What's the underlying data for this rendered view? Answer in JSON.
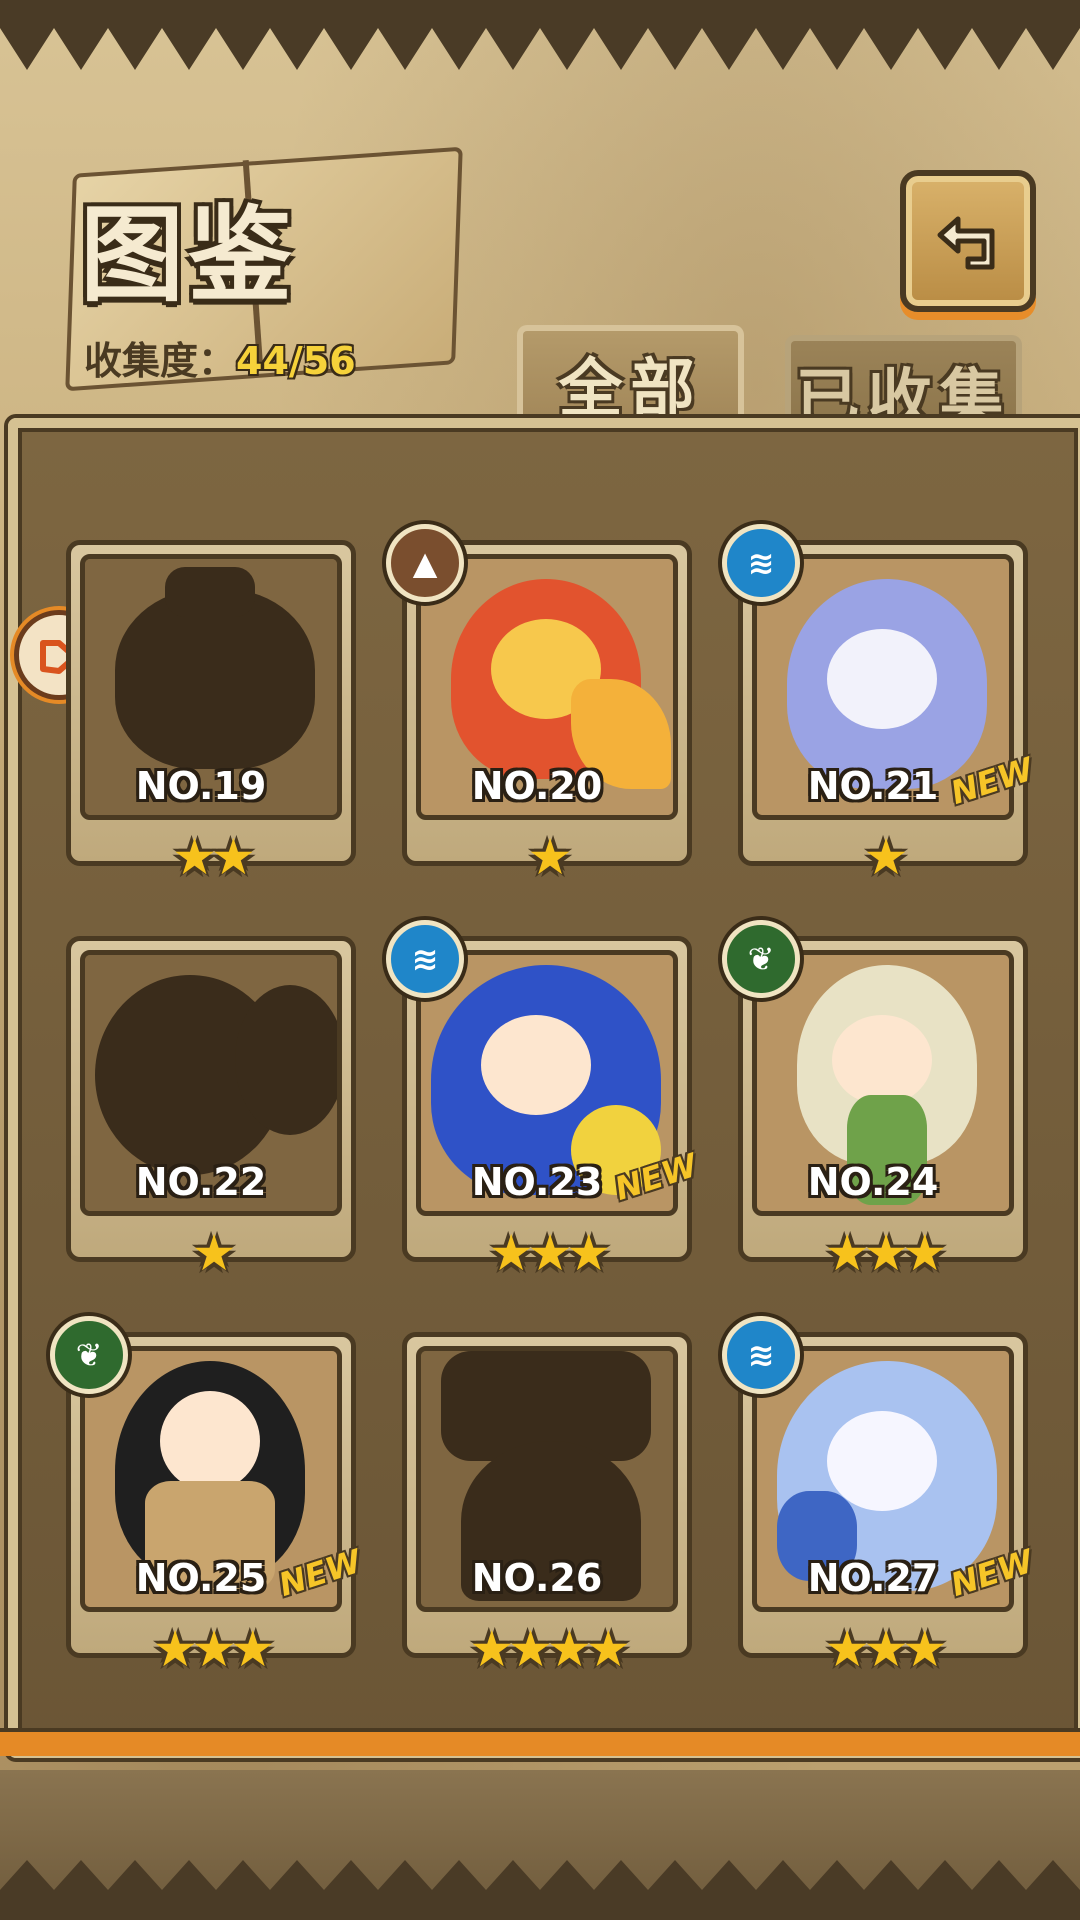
{
  "header": {
    "title": "图鉴",
    "collection_label": "收集度：",
    "collection_value": "44/56"
  },
  "tabs": [
    {
      "label": "全部",
      "active": true
    },
    {
      "label": "已收集",
      "active": false
    }
  ],
  "icons": {
    "back": "back-arrow-icon",
    "scroll": "arrow-marker-icon"
  },
  "cards": [
    {
      "no": "NO.19",
      "stars": "★★",
      "element": "",
      "known": false,
      "new": ""
    },
    {
      "no": "NO.20",
      "stars": "★",
      "element": "earth",
      "known": true,
      "new": ""
    },
    {
      "no": "NO.21",
      "stars": "★",
      "element": "water",
      "known": true,
      "new": "NEW"
    },
    {
      "no": "NO.22",
      "stars": "★",
      "element": "",
      "known": false,
      "new": ""
    },
    {
      "no": "NO.23",
      "stars": "★★★",
      "element": "water",
      "known": true,
      "new": "NEW"
    },
    {
      "no": "NO.24",
      "stars": "★★★",
      "element": "wood",
      "known": true,
      "new": ""
    },
    {
      "no": "NO.25",
      "stars": "★★★",
      "element": "wood",
      "known": true,
      "new": "NEW"
    },
    {
      "no": "NO.26",
      "stars": "★★★★",
      "element": "",
      "known": false,
      "new": ""
    },
    {
      "no": "NO.27",
      "stars": "★★★",
      "element": "water",
      "known": true,
      "new": "NEW"
    }
  ],
  "colors": {
    "accent": "#e58a26",
    "star": "#f7c21c",
    "water": "#1f86c9",
    "earth": "#7a4e2e",
    "wood": "#2f6a2e"
  }
}
